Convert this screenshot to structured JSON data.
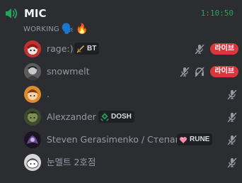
{
  "channel": {
    "name": "MIC",
    "timer": "1:10:50",
    "status_text": "WORKING",
    "status_emojis": [
      "🗣️",
      "🔥"
    ]
  },
  "users": [
    {
      "name": "rage:)",
      "tag": "BT",
      "tag_icon": "sword-icon",
      "live": "라이브",
      "muted": true,
      "deafened": false
    },
    {
      "name": "snowmelt",
      "tag": "",
      "live": "라이브",
      "muted": true,
      "deafened": true
    },
    {
      "name": ".",
      "tag": "",
      "live": "",
      "muted": true,
      "deafened": false
    },
    {
      "name": "Alexzander",
      "tag": "DOSH",
      "tag_icon": "dosh-icon",
      "live": "",
      "muted": true,
      "deafened": false
    },
    {
      "name": "Steven Gerasimenko / Степан",
      "tag": "RUNE",
      "tag_icon": "heart-icon",
      "live": "",
      "muted": true,
      "deafened": false
    },
    {
      "name": "눈멜트 2호점",
      "tag": "",
      "live": "",
      "muted": true,
      "deafened": false
    }
  ],
  "colors": {
    "background": "#2b2d31",
    "live": "#da373c",
    "timer": "#23a55a",
    "muted_icon": "#949ba4"
  }
}
